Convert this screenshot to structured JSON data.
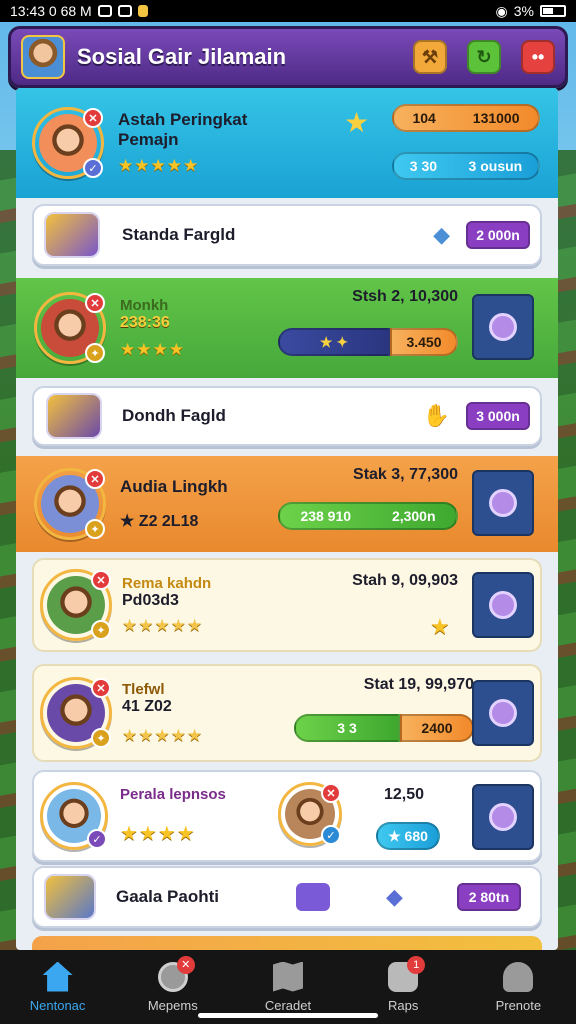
{
  "status_bar": {
    "time": "13:43 0 68 M",
    "battery": "3%"
  },
  "header": {
    "title": "Sosial Gair Jilamain",
    "btn1": "⚒",
    "btn2": "↻",
    "btn3": "••"
  },
  "rows": [
    {
      "name": "Astah Peringkat",
      "name2": "Pemajn",
      "stars": "★★★★★",
      "pill_a": "104",
      "pill_b": "131000",
      "pill_c": "3 30",
      "pill_d": "3 ousun"
    },
    {
      "name": "Standa Fargld",
      "pill": "2 000n"
    },
    {
      "name": "Monkh",
      "sub": "238:36",
      "stars": "★★★★",
      "stat": "Stsh 2, 10,300",
      "bar_a": "★  ✦",
      "bar_b": "3.450"
    },
    {
      "name": "Dondh Fagld",
      "pill": "3 000n"
    },
    {
      "name": "Audia Lingkh",
      "sub": "★ Z2 2L18",
      "stat": "Stak 3, 77,300",
      "bar_a": "238 910",
      "bar_b": "2,300n"
    },
    {
      "name": "Rema kahdn",
      "sub": "Pd03d3",
      "stars": "★★★★★",
      "stat": "Stah 9, 09,903"
    },
    {
      "name": "Tlefwl",
      "sub": "41 Z02",
      "stars": "★★★★★",
      "stat": "Stat 19, 99,970",
      "bar_a": "3 3",
      "bar_b": "2400"
    },
    {
      "name": "Perala lepnsos",
      "stars": "★★★★",
      "score": "12,50",
      "pill": "★ 680"
    },
    {
      "name": "Gaala Paohti",
      "pill": "2 80tn"
    }
  ],
  "nav": [
    {
      "label": "Nentonac",
      "active": true
    },
    {
      "label": "Mepems",
      "badge": "✕"
    },
    {
      "label": "Ceradet"
    },
    {
      "label": "Raps",
      "badge": "1"
    },
    {
      "label": "Prenote"
    }
  ]
}
